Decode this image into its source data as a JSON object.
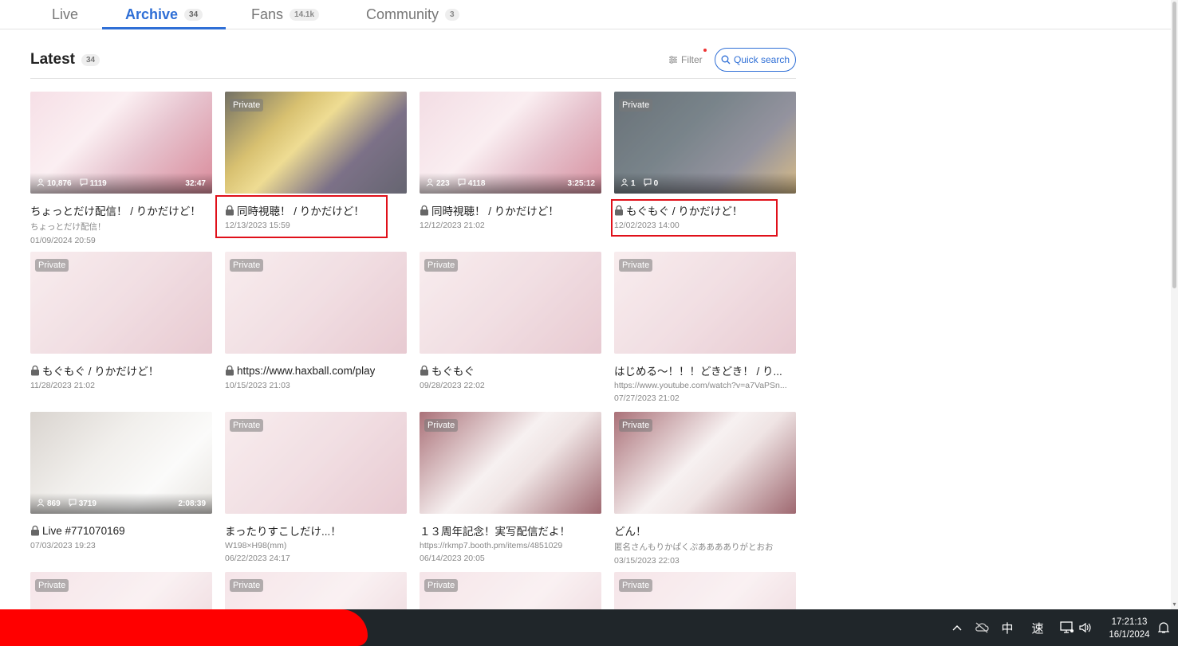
{
  "tabs": [
    {
      "label": "Live",
      "count": ""
    },
    {
      "label": "Archive",
      "count": "34"
    },
    {
      "label": "Fans",
      "count": "14.1k"
    },
    {
      "label": "Community",
      "count": "3"
    }
  ],
  "section": {
    "title": "Latest",
    "count": "34",
    "filter_label": "Filter",
    "search_label": "Quick search"
  },
  "private_label": "Private",
  "videos": [
    {
      "title": "ちょっとだけ配信！ / りかだけど！",
      "subtitle": "ちょっとだけ配信！",
      "date": "01/09/2024 20:59",
      "locked": false,
      "views": "10,876",
      "comments": "1119",
      "duration": "32:47"
    },
    {
      "title": "同時視聴！ / りかだけど！",
      "subtitle": "",
      "date": "12/13/2023 15:59",
      "locked": true,
      "private": true,
      "views": "",
      "comments": "",
      "duration": ""
    },
    {
      "title": "同時視聴！ / りかだけど！",
      "subtitle": "",
      "date": "12/12/2023 21:02",
      "locked": true,
      "views": "223",
      "comments": "4118",
      "duration": "3:25:12"
    },
    {
      "title": "もぐもぐ / りかだけど！",
      "subtitle": "",
      "date": "12/02/2023 14:00",
      "locked": true,
      "private": true,
      "views": "1",
      "comments": "0",
      "duration": ""
    },
    {
      "title": "もぐもぐ / りかだけど！",
      "subtitle": "",
      "date": "11/28/2023 21:02",
      "locked": true,
      "private": true
    },
    {
      "title": "https://www.haxball.com/play",
      "subtitle": "",
      "date": "10/15/2023 21:03",
      "locked": true,
      "private": true
    },
    {
      "title": "もぐもぐ",
      "subtitle": "",
      "date": "09/28/2023 22:02",
      "locked": true,
      "private": true
    },
    {
      "title": "はじめる～！！！どきどき！ / り...",
      "subtitle": "https://www.youtube.com/watch?v=a7VaPSn...",
      "date": "07/27/2023 21:02",
      "locked": false,
      "private": true
    },
    {
      "title": "Live #771070169",
      "subtitle": "",
      "date": "07/03/2023 19:23",
      "locked": true,
      "views": "869",
      "comments": "3719",
      "duration": "2:08:39"
    },
    {
      "title": "まったりすこしだけ...！",
      "subtitle": "W198×H98(mm)",
      "date": "06/22/2023 24:17",
      "locked": false,
      "private": true
    },
    {
      "title": "１３周年記念！実写配信だよ！",
      "subtitle": "https://rkmp7.booth.pm/items/4851029",
      "date": "06/14/2023 20:05",
      "locked": false,
      "private": true
    },
    {
      "title": "どん！",
      "subtitle": "匿名さんもりかぱくぷあああありがとおお",
      "date": "03/15/2023 22:03",
      "locked": false,
      "private": true
    },
    {
      "private": true
    },
    {
      "private": true
    },
    {
      "private": true
    },
    {
      "private": true
    }
  ],
  "taskbar": {
    "ime_mode": "中",
    "ime_speed": "速",
    "time": "17:21:13",
    "date": "16/1/2024"
  },
  "colors": {
    "accent": "#2f6fd6",
    "highlight_box": "#e0101a",
    "taskbar": "#20262a"
  },
  "icons": [
    "chevron-up-icon",
    "cloud-off-icon",
    "monitor-icon",
    "speaker-icon",
    "bell-icon",
    "lock-icon",
    "user-icon",
    "comment-icon",
    "filter-icon",
    "search-icon"
  ]
}
